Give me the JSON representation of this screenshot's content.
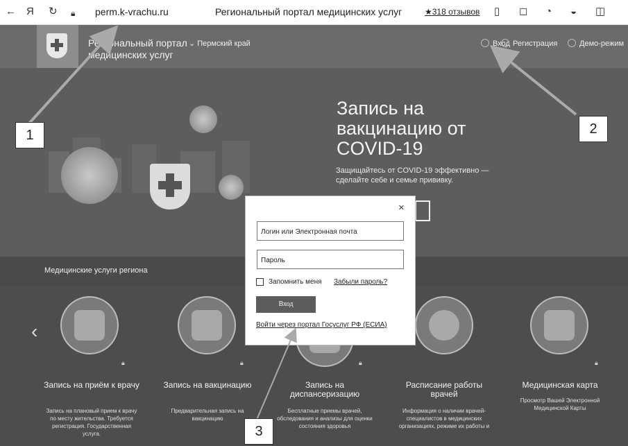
{
  "browser": {
    "back_icon": "←",
    "yandex_icon": "Я",
    "reload_icon": "↻",
    "url": "perm.k-vrachu.ru",
    "tab_title": "Региональный портал медицинских услуг",
    "reviews": "★318 отзывов"
  },
  "header": {
    "portal_name": "Региональный портал медицинских услуг",
    "region": "⌄ Пермский край",
    "login": "Вход",
    "register": "Регистрация",
    "demo": "Демо-режим"
  },
  "hero": {
    "title": "Запись на вакцинацию от COVID-19",
    "subtitle": "Защищайтесь от COVID-19 эффективно — сделайте себе и семье прививку."
  },
  "services": {
    "section_label": "Медицинские услуги региона",
    "cards": [
      {
        "title": "Запись на приём к врачу",
        "desc": "Запись на плановый прием к врачу по месту жительства. Требуется регистрация. Государственная услуга."
      },
      {
        "title": "Запись на вакцинацию",
        "desc": "Предварительная запись на вакцинацию"
      },
      {
        "title": "Запись на диспансеризацию",
        "desc": "Бесплатные приемы врачей, обследования и анализы для оценки состояния здоровья"
      },
      {
        "title": "Расписание работы врачей",
        "desc": "Информация о наличии врачей-специалистов в медицинских организациях, режиме их работы и"
      },
      {
        "title": "Медицинская карта",
        "desc": "Просмотр Вашей Электронной Медицинской Карты"
      }
    ]
  },
  "modal": {
    "close": "×",
    "login_placeholder": "Логин или Электронная почта",
    "password_placeholder": "Пароль",
    "remember": "Запомнить меня",
    "forgot": "Забыли пароль?",
    "enter": "Вход",
    "gosuslugi": "Войти через портал Госуслуг РФ (ЕСИА)"
  },
  "annotations": [
    "1",
    "2",
    "3"
  ]
}
